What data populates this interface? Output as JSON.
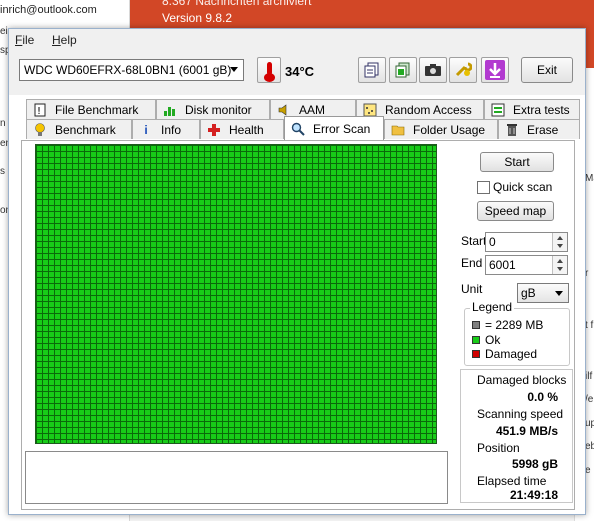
{
  "background": {
    "email": "inrich@outlook.com",
    "left_fragments": [
      "ei",
      "sp",
      "n",
      "en",
      "s",
      "om"
    ],
    "banner_line1": "8.367 Nachrichten archiviert",
    "banner_line2": "Version 9.8.2",
    "right_fragments": [
      "Ma",
      "r",
      "t f",
      "ilf",
      "/e",
      "up",
      "eb",
      "e"
    ]
  },
  "menu": {
    "file": "File",
    "help": "Help"
  },
  "toolbar": {
    "drive": "WDC WD60EFRX-68L0BN1 (6001 gB)",
    "temperature": "34°C",
    "exit_label": "Exit"
  },
  "tabs_top": [
    {
      "label": "File Benchmark",
      "icon": "file-benchmark-icon"
    },
    {
      "label": "Disk monitor",
      "icon": "disk-monitor-icon"
    },
    {
      "label": "AAM",
      "icon": "speaker-icon"
    },
    {
      "label": "Random Access",
      "icon": "random-access-icon"
    },
    {
      "label": "Extra tests",
      "icon": "extra-tests-icon"
    }
  ],
  "tabs_bottom": [
    {
      "label": "Benchmark",
      "icon": "lightbulb-icon"
    },
    {
      "label": "Info",
      "icon": "info-icon"
    },
    {
      "label": "Health",
      "icon": "health-cross-icon"
    },
    {
      "label": "Error Scan",
      "icon": "magnifier-icon",
      "active": true
    },
    {
      "label": "Folder Usage",
      "icon": "folder-icon"
    },
    {
      "label": "Erase",
      "icon": "trash-icon"
    }
  ],
  "controls": {
    "start_button": "Start",
    "quick_scan_label": "Quick scan",
    "quick_scan_checked": false,
    "speed_map_button": "Speed map",
    "start_label": "Start",
    "start_value": "0",
    "end_label": "End",
    "end_value": "6001",
    "unit_label": "Unit",
    "unit_value": "gB"
  },
  "legend": {
    "title": "Legend",
    "block_size": "= 2289 MB",
    "ok": "Ok",
    "damaged": "Damaged",
    "colors": {
      "block": "#808080",
      "ok": "#18cc18",
      "damaged": "#d00000"
    }
  },
  "stats": {
    "damaged_blocks_label": "Damaged blocks",
    "damaged_blocks_value": "0.0 %",
    "scanning_speed_label": "Scanning speed",
    "scanning_speed_value": "451.9 MB/s",
    "position_label": "Position",
    "position_value": "5998 gB",
    "elapsed_label": "Elapsed time",
    "elapsed_value": "21:49:18"
  },
  "scan_grid": {
    "status": "all blocks ok",
    "color": "#18cc18"
  }
}
